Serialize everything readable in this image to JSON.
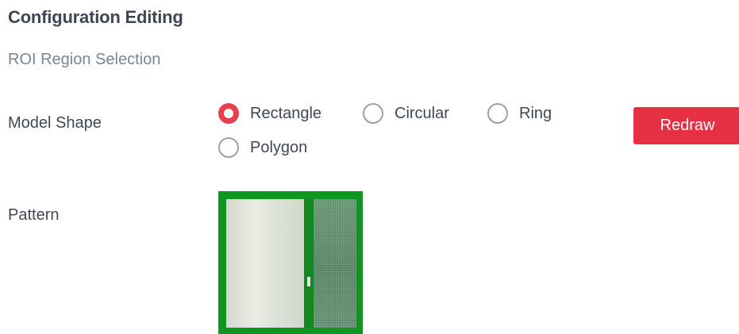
{
  "header": {
    "title": "Configuration Editing",
    "subtitle": "ROI Region Selection"
  },
  "form": {
    "model_shape": {
      "label": "Model Shape",
      "selected": "Rectangle",
      "options": [
        {
          "label": "Rectangle",
          "selected": true
        },
        {
          "label": "Circular",
          "selected": false
        },
        {
          "label": "Ring",
          "selected": false
        },
        {
          "label": "Polygon",
          "selected": false
        }
      ]
    },
    "pattern": {
      "label": "Pattern"
    }
  },
  "buttons": {
    "redraw_label": "Redraw"
  },
  "colors": {
    "primary_red": "#e63145",
    "selected_radio": "#e8404e",
    "roi_border_green": "#129423"
  },
  "icons": {
    "selected_radio": "radio-selected-icon",
    "unselected_radio": "radio-unselected-icon"
  }
}
